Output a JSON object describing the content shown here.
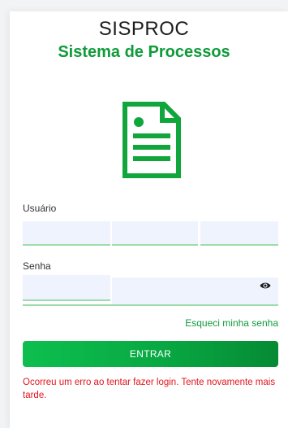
{
  "header": {
    "app_name": "SISPROC",
    "app_subtitle": "Sistema de Processos"
  },
  "icons": {
    "logo": "document-icon",
    "password_toggle": "eye-icon"
  },
  "colors": {
    "brand_green": "#0f9b3a",
    "input_background": "#eef3fe",
    "input_underline": "#9fdcac",
    "error_red": "#e0151d"
  },
  "form": {
    "username_label": "Usuário",
    "username_value": "",
    "password_label": "Senha",
    "password_value": "",
    "forgot_password": "Esqueci minha senha",
    "submit_label": "ENTRAR",
    "error_message": "Ocorreu um erro ao tentar fazer login. Tente novamente mais tarde."
  }
}
